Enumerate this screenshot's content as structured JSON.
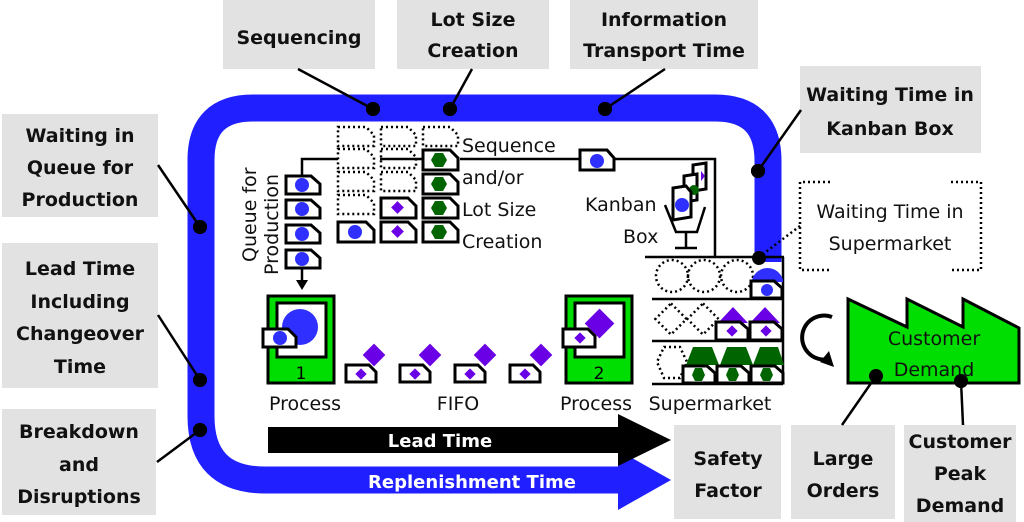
{
  "colors": {
    "loop_blue": "#1f1fff",
    "process_green": "#00dd00",
    "part_blue": "#2f2fff",
    "part_purple": "#6a00e6",
    "part_darkgreen": "#006400",
    "label_gray": "#e2e2e2",
    "black": "#000000",
    "white": "#ffffff"
  },
  "callouts": {
    "sequencing": [
      "Sequencing"
    ],
    "lot_size_creation": [
      "Lot Size",
      "Creation"
    ],
    "information_transport_time": [
      "Information",
      "Transport Time"
    ],
    "waiting_in_kanban_box": [
      "Waiting Time in",
      "Kanban Box"
    ],
    "waiting_in_supermarket": [
      "Waiting Time in",
      "Supermarket"
    ],
    "waiting_in_queue": [
      "Waiting in",
      "Queue for",
      "Production"
    ],
    "lead_time_changeover": [
      "Lead Time",
      "Including",
      "Changeover",
      "Time"
    ],
    "breakdown": [
      "Breakdown",
      "and",
      "Disruptions"
    ],
    "safety_factor": [
      "Safety",
      "Factor"
    ],
    "large_orders": [
      "Large",
      "Orders"
    ],
    "customer_peak_demand": [
      "Customer",
      "Peak",
      "Demand"
    ]
  },
  "diagram": {
    "queue_label": [
      "Queue for",
      "Production"
    ],
    "sequence_label": [
      "Sequence",
      "and/or",
      "Lot Size",
      "Creation"
    ],
    "kanban_box_label": [
      "Kanban",
      "Box"
    ],
    "process1_number": "1",
    "process2_number": "2",
    "process1_label": "Process",
    "fifo_label": "FIFO",
    "process2_label": "Process",
    "supermarket_label": "Supermarket",
    "customer_label": [
      "Customer",
      "Demand"
    ],
    "lead_time_arrow": "Lead Time",
    "replenishment_arrow": "Replenishment Time"
  }
}
